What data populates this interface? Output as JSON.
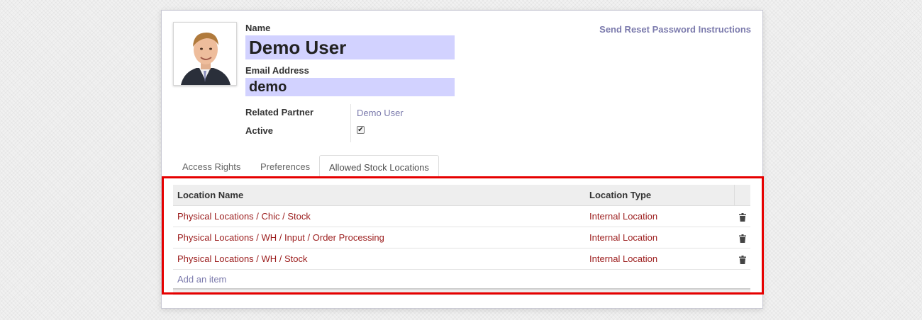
{
  "form": {
    "name_label": "Name",
    "name_value": "Demo User",
    "email_label": "Email Address",
    "email_value": "demo",
    "related_partner_label": "Related Partner",
    "related_partner_value": "Demo User",
    "active_label": "Active",
    "active_checked": true,
    "reset_password_link": "Send Reset Password Instructions"
  },
  "tabs": [
    {
      "label": "Access Rights",
      "active": false
    },
    {
      "label": "Preferences",
      "active": false
    },
    {
      "label": "Allowed Stock Locations",
      "active": true
    }
  ],
  "locations_table": {
    "columns": [
      "Location Name",
      "Location Type"
    ],
    "rows": [
      {
        "name": "Physical Locations / Chic / Stock",
        "type": "Internal Location"
      },
      {
        "name": "Physical Locations / WH / Input / Order Processing",
        "type": "Internal Location"
      },
      {
        "name": "Physical Locations / WH / Stock",
        "type": "Internal Location"
      }
    ],
    "add_item_label": "Add an item"
  },
  "colors": {
    "input_highlight": "#d2d2ff",
    "link": "#7c7bad",
    "row_text": "#9b1c1c",
    "annotation_border": "#e60000"
  }
}
